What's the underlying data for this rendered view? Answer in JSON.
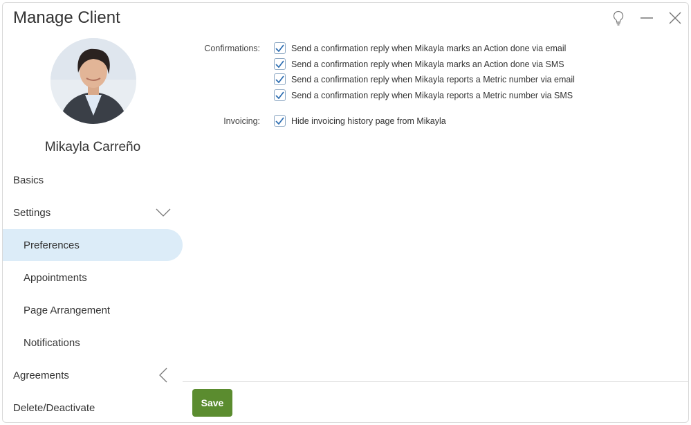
{
  "window": {
    "title": "Manage Client",
    "controls": [
      "lightbulb-icon",
      "minimize-icon",
      "close-icon"
    ]
  },
  "client": {
    "name": "Mikayla Carreño"
  },
  "sidebar": {
    "items": [
      {
        "label": "Basics",
        "level": "top",
        "active": false
      },
      {
        "label": "Settings",
        "level": "top",
        "active": false,
        "chevron": "chevron-down-icon"
      },
      {
        "label": "Preferences",
        "level": "sub",
        "active": true
      },
      {
        "label": "Appointments",
        "level": "sub",
        "active": false
      },
      {
        "label": "Page Arrangement",
        "level": "sub",
        "active": false
      },
      {
        "label": "Notifications",
        "level": "sub",
        "active": false
      },
      {
        "label": "Agreements",
        "level": "top",
        "active": false,
        "chevron": "chevron-left-icon"
      },
      {
        "label": "Delete/Deactivate",
        "level": "top",
        "active": false
      }
    ]
  },
  "preferences": {
    "confirmations_label": "Confirmations:",
    "confirmations": [
      {
        "label": "Send a confirmation reply when Mikayla marks an Action done via email",
        "checked": true
      },
      {
        "label": "Send a confirmation reply when Mikayla marks an Action done via SMS",
        "checked": true
      },
      {
        "label": "Send a confirmation reply when Mikayla reports a Metric number via email",
        "checked": true
      },
      {
        "label": "Send a confirmation reply when Mikayla reports a Metric number via SMS",
        "checked": true
      }
    ],
    "invoicing_label": "Invoicing:",
    "invoicing": [
      {
        "label": "Hide invoicing history page from Mikayla",
        "checked": true
      }
    ]
  },
  "footer": {
    "save_label": "Save"
  },
  "colors": {
    "accent_green": "#5b8c2f",
    "active_nav_bg": "#dcecf8",
    "check_blue": "#2f6fb2"
  }
}
